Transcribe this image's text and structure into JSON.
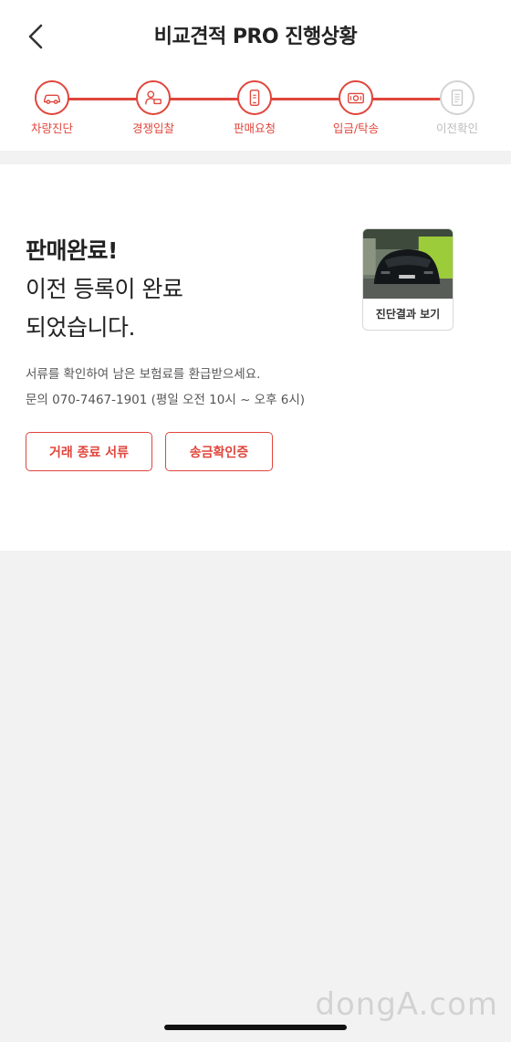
{
  "header": {
    "title": "비교견적 PRO 진행상황"
  },
  "steps": [
    {
      "label": "차량진단",
      "icon": "car-icon",
      "state": "done"
    },
    {
      "label": "경쟁입찰",
      "icon": "bidding-person-icon",
      "state": "done"
    },
    {
      "label": "판매요청",
      "icon": "mobile-phone-icon",
      "state": "done"
    },
    {
      "label": "입금/탁송",
      "icon": "money-icon",
      "state": "done"
    },
    {
      "label": "이전확인",
      "icon": "document-icon",
      "state": "inactive"
    }
  ],
  "status": {
    "headline_bold": "판매완료!",
    "headline_line2": "이전 등록이 완료",
    "headline_line3": "되었습니다.",
    "desc_line1": "서류를 확인하여 남은 보험료를 환급받으세요.",
    "desc_line2": "문의 070-7467-1901 (평일 오전 10시 ~ 오후 6시)"
  },
  "thumbnail": {
    "label": "진단결과 보기"
  },
  "buttons": {
    "documents": "거래 종료 서류",
    "remittance": "송금확인증"
  },
  "watermark": "dongA.com",
  "colors": {
    "accent": "#e0463c",
    "inactive": "#d3d3d3"
  }
}
